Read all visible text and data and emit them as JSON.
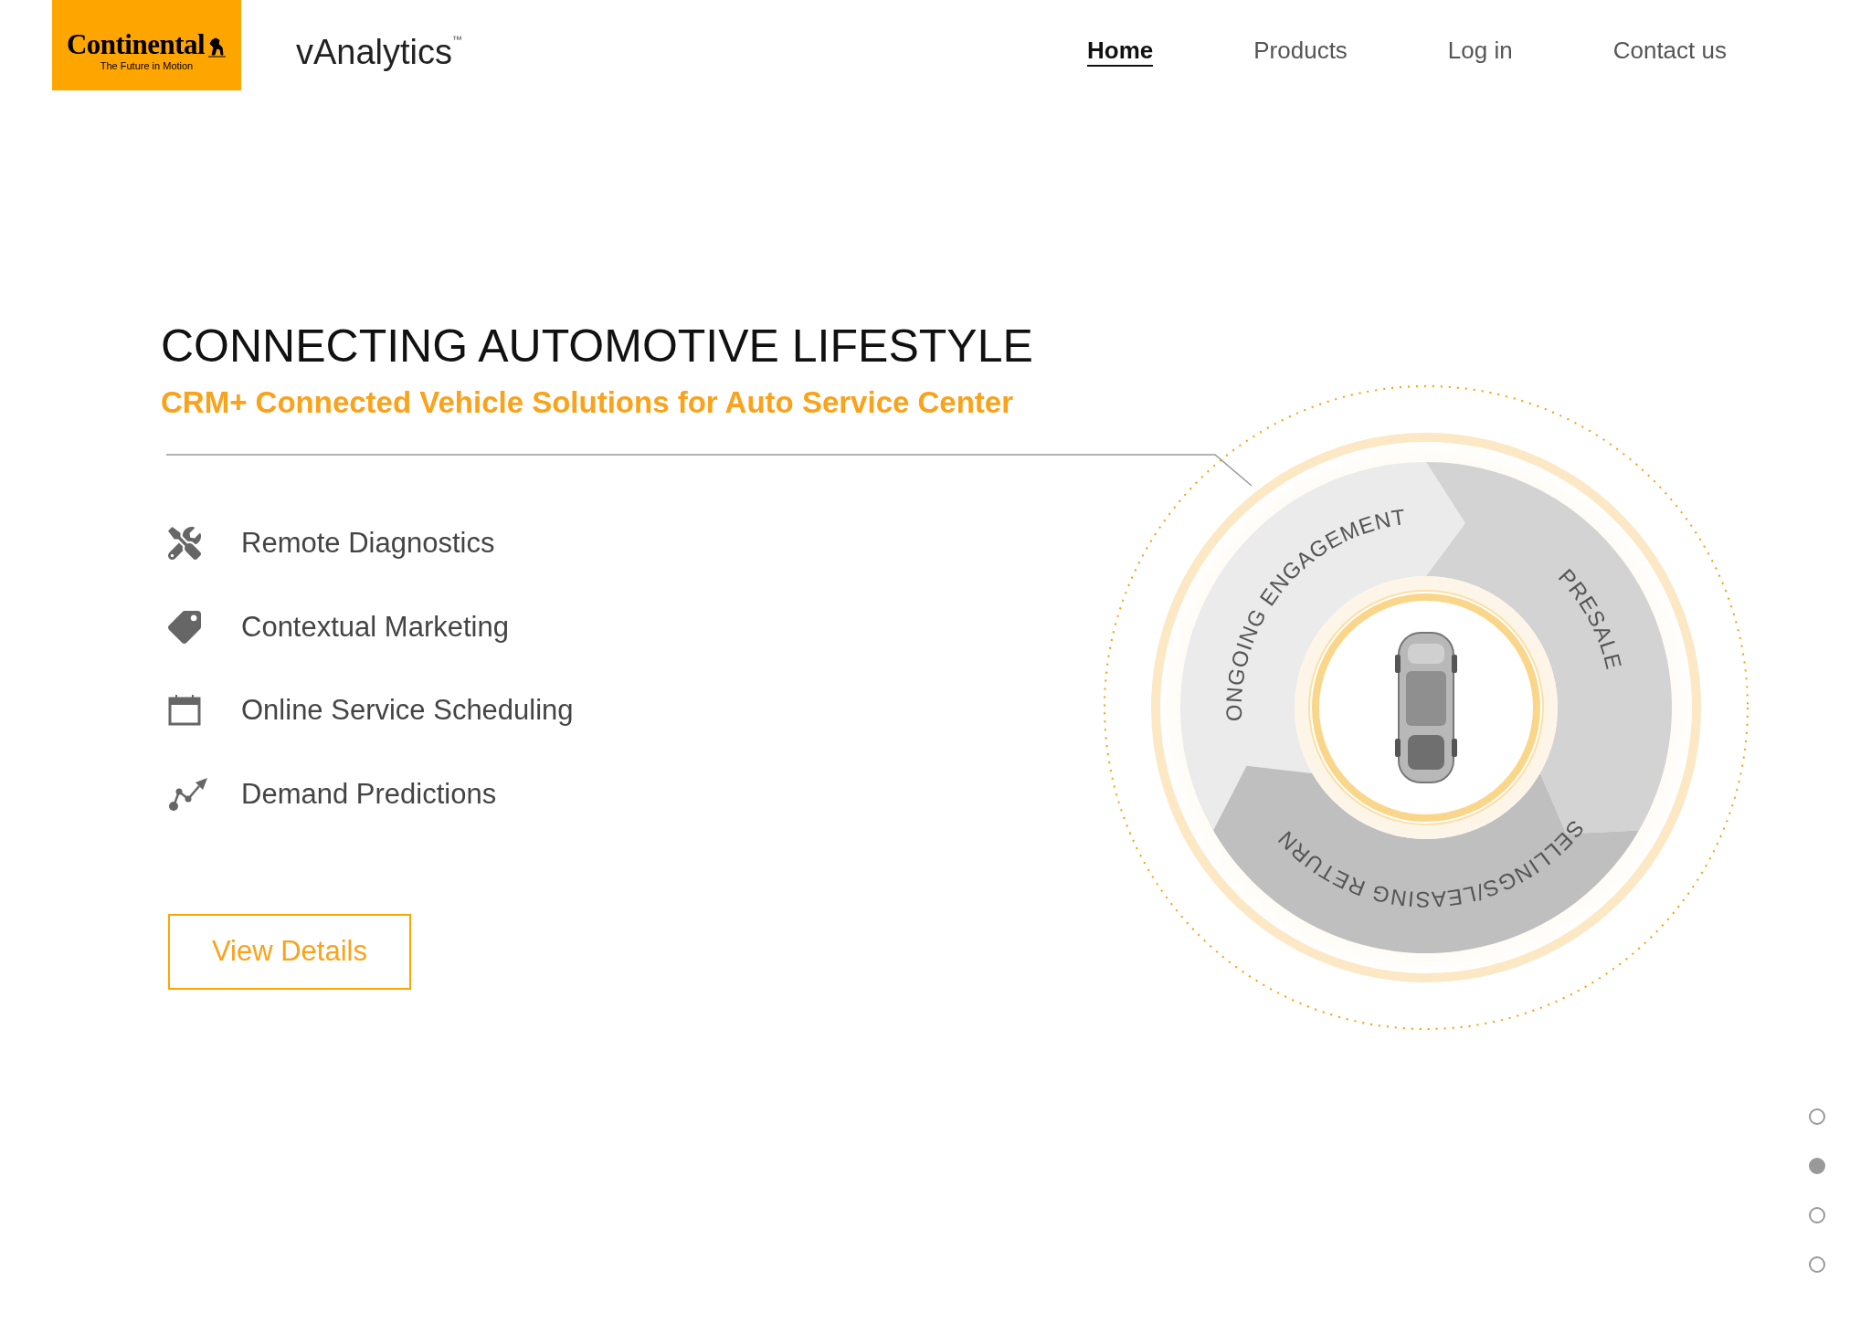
{
  "header": {
    "logo": {
      "brand": "Continental",
      "tagline": "The Future in Motion"
    },
    "product": {
      "name": "vAnalytics",
      "mark": "™"
    },
    "nav": [
      {
        "label": "Home",
        "selected": true
      },
      {
        "label": "Products",
        "selected": false
      },
      {
        "label": "Log in",
        "selected": false
      },
      {
        "label": "Contact us",
        "selected": false
      }
    ]
  },
  "hero": {
    "title": "CONNECTING AUTOMOTIVE LIFESTYLE",
    "subtitle": "CRM+ Connected Vehicle Solutions for Auto Service Center",
    "features": [
      {
        "label": "Remote Diagnostics"
      },
      {
        "label": "Contextual Marketing"
      },
      {
        "label": "Online Service Scheduling"
      },
      {
        "label": "Demand Predictions"
      }
    ],
    "button": "View Details"
  },
  "diagram": {
    "segments": [
      {
        "label": "ONGOING ENGAGEMENT"
      },
      {
        "label": "PRESALE"
      },
      {
        "label": "SELLINGS/LEASING RETURN"
      }
    ]
  },
  "pager": [
    {
      "selected": false
    },
    {
      "selected": true
    },
    {
      "selected": false
    },
    {
      "selected": false
    }
  ]
}
